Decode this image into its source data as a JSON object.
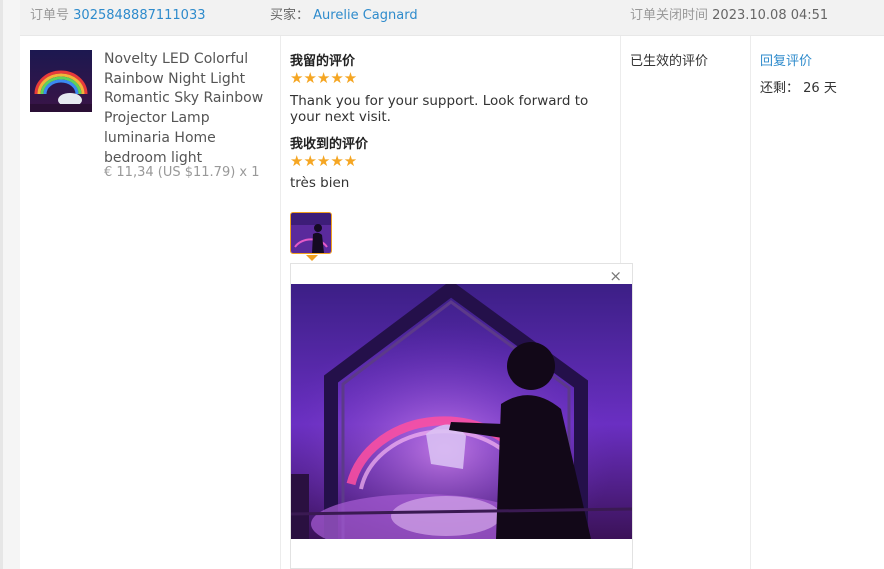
{
  "header": {
    "order_label": "订单号",
    "order_number": "3025848887111033",
    "buyer_label": "买家：",
    "buyer_name": "Aurelie Cagnard",
    "closed_label": "订单关闭时间",
    "closed_time": "2023.10.08 04:51"
  },
  "product": {
    "title": "Novelty LED Colorful Rainbow Night Light Romantic Sky Rainbow Projector Lamp luminaria Home bedroom light",
    "price": "€ 11,34 (US $11.79) x 1"
  },
  "my_review": {
    "heading": "我留的评价",
    "stars": "★★★★★",
    "text": "Thank you for your support. Look forward to your next visit."
  },
  "received_review": {
    "heading": "我收到的评价",
    "stars": "★★★★★",
    "text": "très bien"
  },
  "viewer": {
    "close_symbol": "×"
  },
  "status": {
    "label": "已生效的评价"
  },
  "actions": {
    "reply_label": "回复评价",
    "remaining_label": "还剩：",
    "remaining_value": "26 天"
  },
  "colors": {
    "link": "#2e8bcc",
    "star": "#f5a623",
    "accent_border": "#f0a020"
  }
}
